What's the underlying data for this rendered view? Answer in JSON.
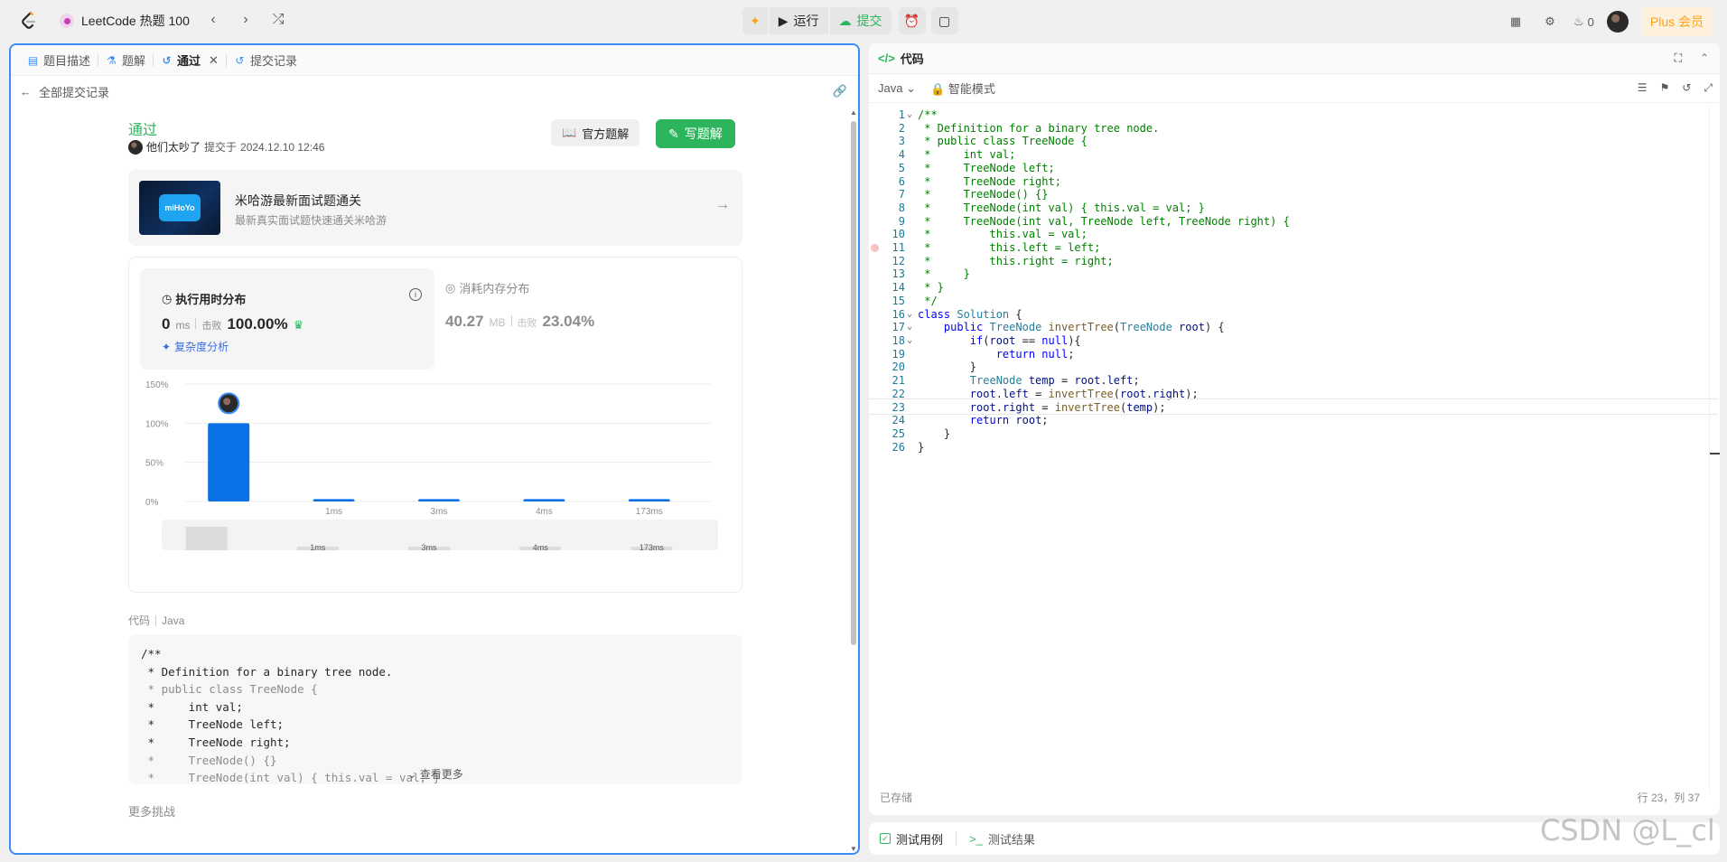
{
  "topbar": {
    "problem_list": "LeetCode 热题 100",
    "run_label": "运行",
    "submit_label": "提交",
    "fire_count": "0",
    "plus_label": "Plus 会员"
  },
  "left": {
    "tabs": [
      {
        "label": "题目描述"
      },
      {
        "label": "题解"
      },
      {
        "label": "通过"
      },
      {
        "label": "提交记录"
      }
    ],
    "back_label": "全部提交记录",
    "status": "通过",
    "user": "他们太吵了",
    "submitted_prefix": "提交于",
    "submitted_at": "2024.12.10 12:46",
    "official_solution": "官方题解",
    "write_solution": "写题解",
    "banner": {
      "thumb_text": "miHoYo",
      "title": "米哈游最新面试题通关",
      "desc": "最新真实面试题快速通关米哈游"
    },
    "runtime": {
      "title": "执行用时分布",
      "value": "0",
      "unit": "ms",
      "beats_label": "击败",
      "beats": "100.00%",
      "complexity": "复杂度分析"
    },
    "memory": {
      "title": "消耗内存分布",
      "value": "40.27",
      "unit": "MB",
      "beats_label": "击败",
      "beats": "23.04%"
    },
    "code_label": "代码",
    "code_lang": "Java",
    "code_preview": [
      "/**",
      " * Definition for a binary tree node.",
      " * public class TreeNode {",
      " *     int val;",
      " *     TreeNode left;",
      " *     TreeNode right;",
      " *     TreeNode() {}",
      " *     TreeNode(int val) { this.val = val; }"
    ],
    "view_more": "查看更多",
    "more_challenges": "更多挑战"
  },
  "chart_data": {
    "type": "bar",
    "categories": [
      "0ms",
      "1ms",
      "3ms",
      "4ms",
      "173ms"
    ],
    "x_tick_labels": [
      "",
      "1ms",
      "3ms",
      "4ms",
      "173ms"
    ],
    "values": [
      100,
      3,
      3,
      3,
      3
    ],
    "yticks": [
      "0%",
      "50%",
      "100%",
      "150%"
    ],
    "ylim": [
      0,
      150
    ],
    "grid": true,
    "highlight_index": 0,
    "bar_color": "#0a72e6",
    "overview_labels": [
      "1ms",
      "3ms",
      "4ms",
      "173ms"
    ]
  },
  "right": {
    "title": "代码",
    "language": "Java",
    "mode": "智能模式",
    "saved": "已存储",
    "cursor": "行 23，列 37",
    "code": [
      "/**",
      " * Definition for a binary tree node.",
      " * public class TreeNode {",
      " *     int val;",
      " *     TreeNode left;",
      " *     TreeNode right;",
      " *     TreeNode() {}",
      " *     TreeNode(int val) { this.val = val; }",
      " *     TreeNode(int val, TreeNode left, TreeNode right) {",
      " *         this.val = val;",
      " *         this.left = left;",
      " *         this.right = right;",
      " *     }",
      " * }",
      " */",
      "class Solution {",
      "    public TreeNode invertTree(TreeNode root) {",
      "        if(root == null){",
      "            return null;",
      "        }",
      "        TreeNode temp = root.left;",
      "        root.left = invertTree(root.right);",
      "        root.right = invertTree(temp);",
      "        return root;",
      "    }",
      "}"
    ]
  },
  "bottom": {
    "testcase": "测试用例",
    "result": "测试结果"
  },
  "watermark": "CSDN @L_cl",
  "colors": {
    "accent_green": "#2db55d",
    "focus_blue": "#3b8cf5",
    "bar_blue": "#0a72e6"
  }
}
